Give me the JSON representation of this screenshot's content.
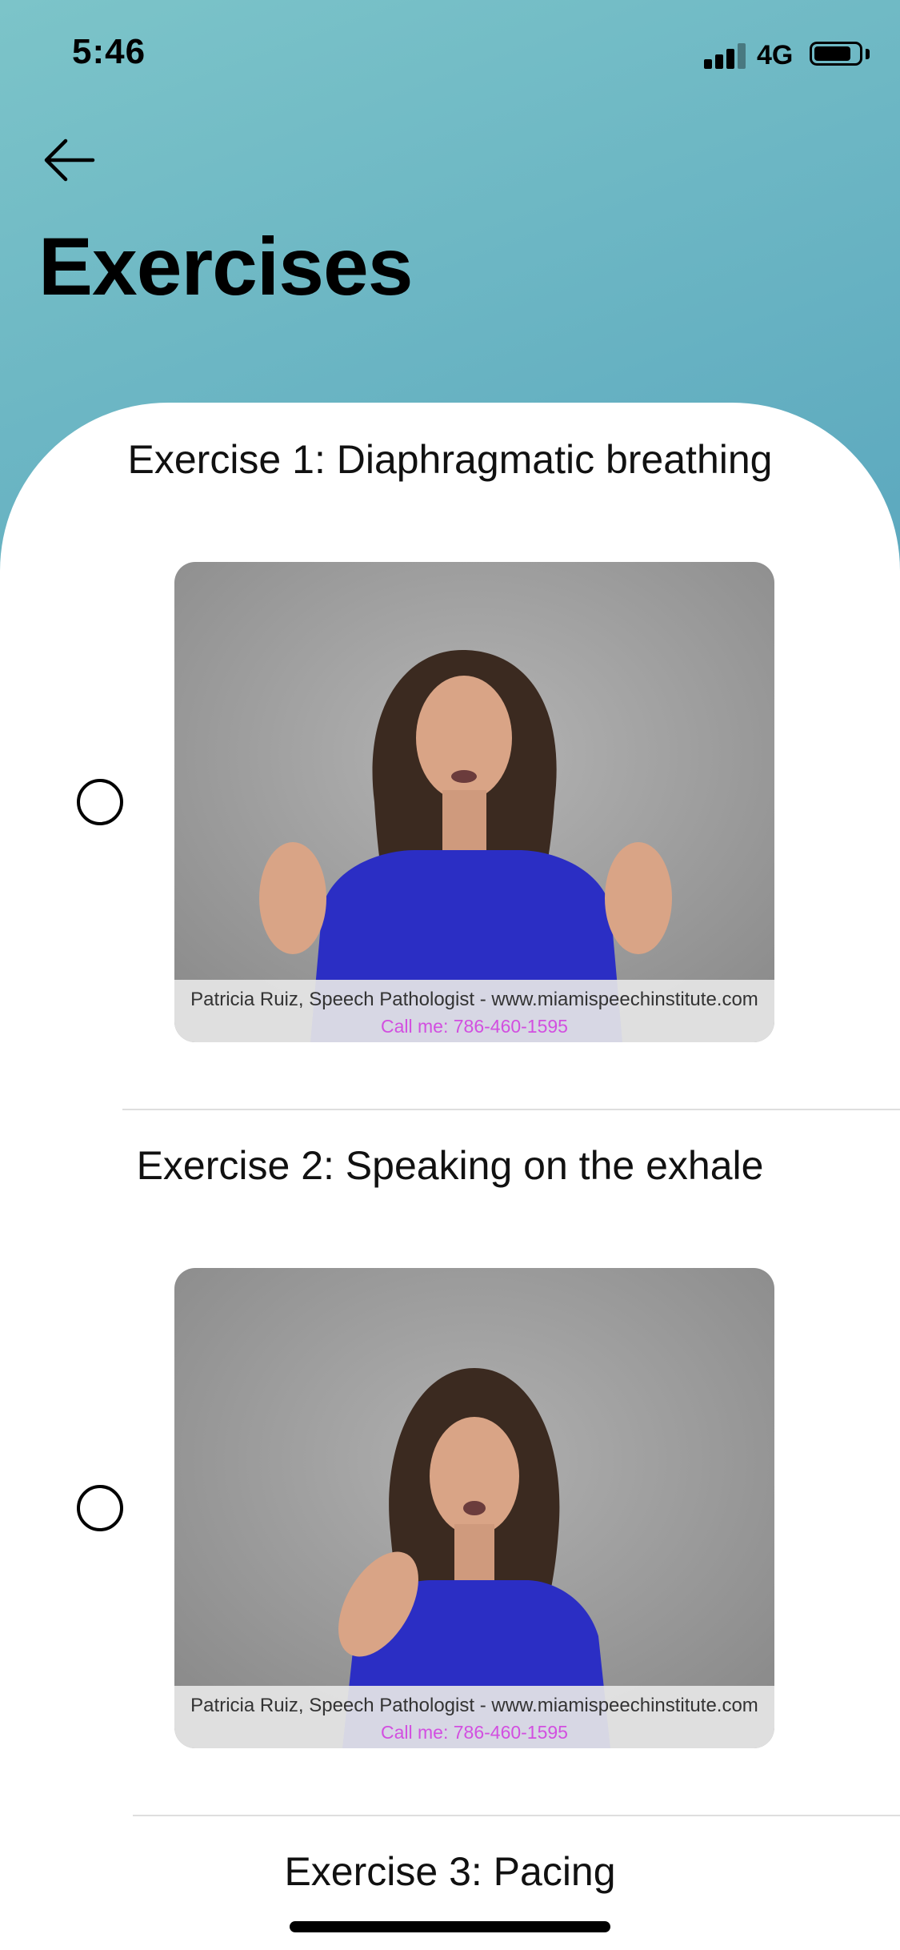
{
  "status_bar": {
    "time": "5:46",
    "network": "4G"
  },
  "header": {
    "title": "Exercises"
  },
  "exercises": [
    {
      "title": "Exercise 1: Diaphragmatic breathing",
      "completed": false,
      "video": {
        "caption_line1": "Patricia Ruiz, Speech Pathologist - www.miamispeechinstitute.com",
        "caption_line2": "Call me: 786-460-1595"
      }
    },
    {
      "title": "Exercise 2: Speaking on the exhale",
      "completed": false,
      "video": {
        "caption_line1": "Patricia Ruiz, Speech Pathologist - www.miamispeechinstitute.com",
        "caption_line2": "Call me: 786-460-1595"
      }
    },
    {
      "title": "Exercise 3: Pacing"
    }
  ],
  "colors": {
    "header_gradient_start": "#7cc4c9",
    "header_gradient_end": "#4a95b5",
    "video_background": "#9a9a9a",
    "shirt_blue": "#2b2ec4",
    "caption_text": "#333333",
    "caption_phone": "#d24fe0"
  }
}
